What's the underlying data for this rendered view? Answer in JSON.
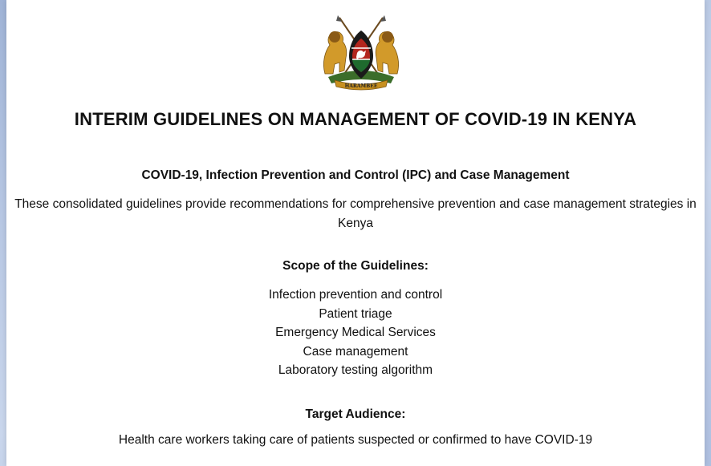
{
  "crest": {
    "motto": "HARAMBEE",
    "colors": {
      "black": "#1a1a1a",
      "red": "#b3261e",
      "green": "#1f6b2e",
      "gold": "#c8901f",
      "white": "#ffffff"
    }
  },
  "document": {
    "title": "INTERIM GUIDELINES ON MANAGEMENT OF COVID-19 IN KENYA",
    "subtitle": "COVID-19, Infection Prevention and Control (IPC) and Case Management",
    "intro": "These consolidated guidelines provide recommendations for comprehensive prevention and case management strategies in Kenya",
    "scope": {
      "heading": "Scope of the Guidelines:",
      "items": [
        "Infection prevention and control",
        "Patient triage",
        "Emergency Medical Services",
        "Case management",
        "Laboratory testing algorithm"
      ]
    },
    "audience": {
      "heading": "Target Audience:",
      "text": "Health care workers taking care of patients suspected or confirmed to have COVID-19"
    }
  }
}
